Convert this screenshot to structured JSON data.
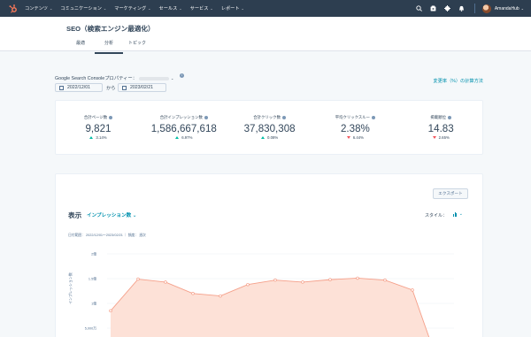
{
  "nav": {
    "items": [
      "コンテンツ",
      "コミュニケーション",
      "マーケティング",
      "セールス",
      "サービス",
      "レポート"
    ],
    "account_name": "AmandaHub"
  },
  "header": {
    "title": "SEO（検索エンジン最適化）",
    "tabs": [
      "最適",
      "分析",
      "トピック"
    ],
    "active_tab": "分析"
  },
  "filters": {
    "property_label": "Google Search Consoleプロパティー：",
    "date_from": "2022/12/01",
    "from_to": "から",
    "date_to": "2023/02/21",
    "calc_link": "変更率（%）の計算方法"
  },
  "kpis": [
    {
      "label": "合計ページ数",
      "value": "9,821",
      "change": "3.14%",
      "direction": "up"
    },
    {
      "label": "合計インプレッション数",
      "value": "1,586,667,618",
      "change": "6.97%",
      "direction": "up"
    },
    {
      "label": "合計クリック数",
      "value": "37,830,308",
      "change": "0.08%",
      "direction": "up"
    },
    {
      "label": "平均クリックスルー",
      "value": "2.38%",
      "change": "6.44%",
      "direction": "down"
    },
    {
      "label": "掲載順位",
      "value": "14.83",
      "change": "2.65%",
      "direction": "down"
    }
  ],
  "chart_section": {
    "export_label": "エクスポート",
    "heading": "表示",
    "metric": "インプレッション数",
    "style_label": "スタイル：",
    "period_text": "日付範囲： 2022/12/01〜2023/02/21 ｜ 頻度： 週次",
    "y_axis_label": "インプレッション数"
  },
  "colors": {
    "nav_bg": "#2d3e50",
    "accent": "#0091ae",
    "up": "#00bda5",
    "down": "#f2545b",
    "area_fill": "#fde1d7",
    "area_line": "#f5a08a"
  },
  "chart_data": {
    "type": "area",
    "ylabel": "インプレッション数",
    "y_ticks": [
      "2億",
      "1.5億",
      "1億",
      "5,000万"
    ],
    "y_tick_values": [
      200000000,
      150000000,
      100000000,
      50000000
    ],
    "ylim": [
      0,
      200000000
    ],
    "values": [
      85000000,
      149000000,
      143000000,
      120000000,
      115000000,
      138000000,
      147000000,
      143000000,
      148000000,
      151000000,
      147000000,
      127000000,
      0
    ],
    "markers": [
      true,
      true,
      true,
      true,
      true,
      true,
      true,
      true,
      true,
      true,
      true,
      true,
      false
    ],
    "grid": true
  }
}
